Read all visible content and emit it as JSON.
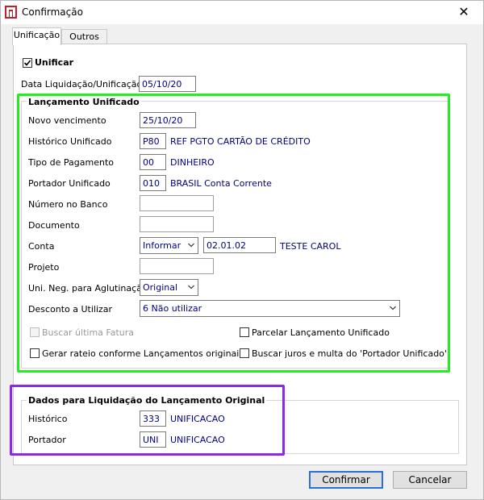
{
  "window": {
    "title": "Confirmação",
    "close": "✕"
  },
  "tabs": [
    {
      "label": "Unificação",
      "active": true
    },
    {
      "label": "Outros",
      "active": false
    }
  ],
  "unificar": {
    "label": "Unificar",
    "checked": true
  },
  "data_liquidacao": {
    "label": "Data Liquidação/Unificação",
    "value": "05/10/20"
  },
  "lancamento": {
    "title": "Lançamento Unificado",
    "novo_vencimento": {
      "label": "Novo vencimento",
      "value": "25/10/20"
    },
    "historico": {
      "label": "Histórico Unificado",
      "code": "P80",
      "desc": "REF PGTO CARTÃO DE CRÉDITO"
    },
    "tipo_pagamento": {
      "label": "Tipo de Pagamento",
      "code": "00",
      "desc": "DINHEIRO"
    },
    "portador": {
      "label": "Portador Unificado",
      "code": "010",
      "desc": "BRASIL Conta Corrente"
    },
    "numero_banco": {
      "label": "Número no Banco",
      "value": ""
    },
    "documento": {
      "label": "Documento",
      "value": ""
    },
    "conta": {
      "label": "Conta",
      "mode": "Informar",
      "code": "02.01.02",
      "desc": "TESTE CAROL"
    },
    "projeto": {
      "label": "Projeto",
      "value": ""
    },
    "uni_neg": {
      "label": "Uni. Neg. para Aglutinação",
      "value": "Original"
    },
    "desconto": {
      "label": "Desconto a Utilizar",
      "value": "6 Não utilizar"
    },
    "buscar_fatura": {
      "label": "Buscar última Fatura",
      "checked": false,
      "disabled": true
    },
    "parcelar": {
      "label": "Parcelar Lançamento Unificado",
      "checked": false
    },
    "gerar_rateio": {
      "label": "Gerar rateio conforme Lançamentos originais",
      "checked": false
    },
    "buscar_juros": {
      "label": "Buscar juros e multa do 'Portador Unificado'",
      "checked": false
    }
  },
  "liquidacao": {
    "title": "Dados para Liquidação do Lançamento Original",
    "historico": {
      "label": "Histórico",
      "code": "333",
      "desc": "UNIFICACAO"
    },
    "portador": {
      "label": "Portador",
      "code": "UNI",
      "desc": "UNIFICACAO"
    }
  },
  "buttons": {
    "confirmar": "Confirmar",
    "cancelar": "Cancelar"
  },
  "colors": {
    "highlight_green": "#22ee22",
    "highlight_purple": "#8a2be2",
    "value_text": "#000080"
  },
  "icons": {
    "app": "app-logo-icon",
    "check": "checkmark-icon",
    "dropdown": "chevron-down-icon"
  }
}
